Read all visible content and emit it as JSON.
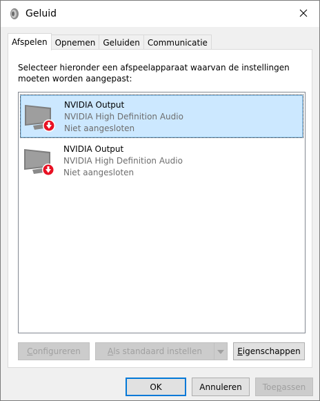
{
  "window": {
    "title": "Geluid",
    "icon": "speaker-icon"
  },
  "tabs": [
    {
      "label": "Afspelen",
      "active": true
    },
    {
      "label": "Opnemen",
      "active": false
    },
    {
      "label": "Geluiden",
      "active": false
    },
    {
      "label": "Communicatie",
      "active": false
    }
  ],
  "instruction": "Selecteer hieronder een afspeelapparaat waarvan de instellingen moeten worden aangepast:",
  "devices": [
    {
      "name": "NVIDIA Output",
      "description": "NVIDIA High Definition Audio",
      "status": "Niet aangesloten",
      "icon": "monitor-icon",
      "badge": "disconnected-icon",
      "selected": true
    },
    {
      "name": "NVIDIA Output",
      "description": "NVIDIA High Definition Audio",
      "status": "Niet aangesloten",
      "icon": "monitor-icon",
      "badge": "disconnected-icon",
      "selected": false
    }
  ],
  "panel_buttons": {
    "configure": {
      "accel": "C",
      "rest": "onfigureren"
    },
    "set_default": {
      "accel": "A",
      "rest": "ls standaard instellen"
    },
    "properties": {
      "accel": "E",
      "rest": "igenschappen"
    }
  },
  "dialog_buttons": {
    "ok": "OK",
    "cancel": "Annuleren",
    "apply_pre": "Toe",
    "apply_accel": "p",
    "apply_post": "assen"
  },
  "colors": {
    "selection": "#cce8ff",
    "accent": "#0078d7",
    "badge_red": "#e81123"
  }
}
